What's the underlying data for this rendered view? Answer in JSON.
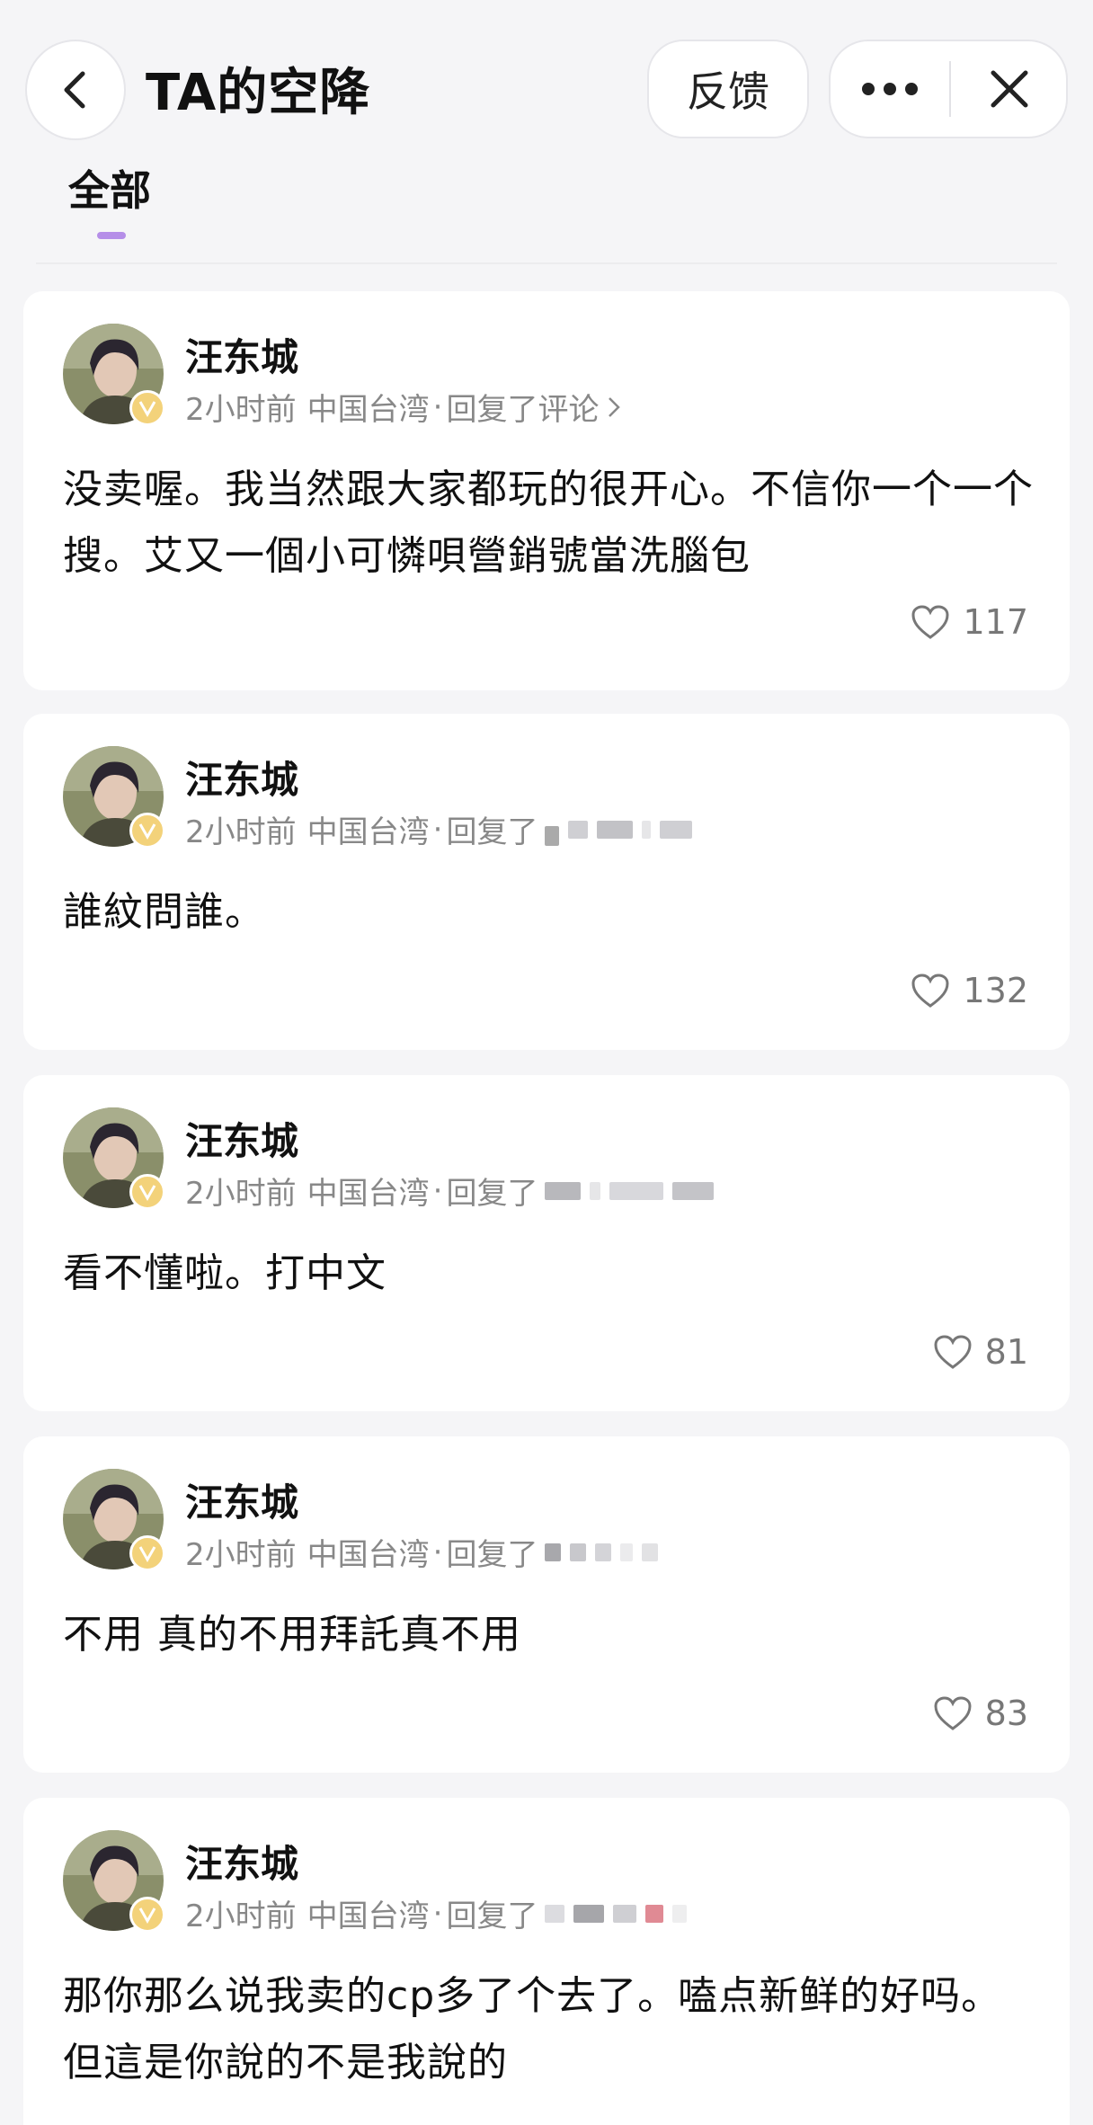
{
  "header": {
    "title": "TA的空降",
    "feedback_label": "反馈"
  },
  "tabs": [
    {
      "label": "全部",
      "active": true
    }
  ],
  "colors": {
    "accent": "#b58ee8",
    "badge": "#f3d27a",
    "meta_text": "#888888"
  },
  "posts": [
    {
      "name": "汪东城",
      "time": "2小时前",
      "location": "中国台湾",
      "action": "回复了评论",
      "content": "没卖喔。我当然跟大家都玩的很开心。不信你一个一个搜。艾又一個小可憐唄營銷號當洗腦包",
      "likes": "117"
    },
    {
      "name": "汪东城",
      "time": "2小时前",
      "location": "中国台湾",
      "action": "回复了",
      "content": "誰紋問誰。",
      "likes": "132"
    },
    {
      "name": "汪东城",
      "time": "2小时前",
      "location": "中国台湾",
      "action": "回复了",
      "content": "看不懂啦。打中文",
      "likes": "81"
    },
    {
      "name": "汪东城",
      "time": "2小时前",
      "location": "中国台湾",
      "action": "回复了",
      "content": "不用 真的不用拜託真不用",
      "likes": "83"
    },
    {
      "name": "汪东城",
      "time": "2小时前",
      "location": "中国台湾",
      "action": "回复了",
      "content": "那你那么说我卖的cp多了个去了。嗑点新鲜的好吗。但這是你說的不是我說的",
      "likes": ""
    }
  ]
}
